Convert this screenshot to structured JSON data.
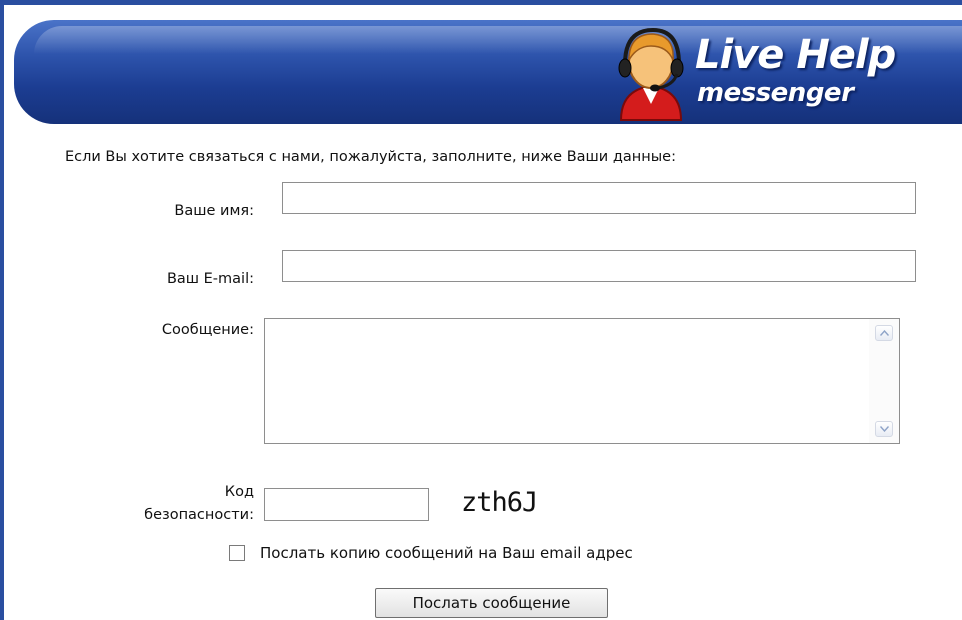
{
  "header": {
    "logo_line1": "Live Help",
    "logo_line2": "messenger",
    "icon": "headset-operator-icon",
    "colors": {
      "header_dark": "#15317a",
      "header_light": "#4a73c8",
      "frame": "#2a4ea0"
    }
  },
  "form": {
    "intro": "Если Вы хотите связаться с нами, пожалуйста, заполните, ниже Ваши данные:",
    "name_label": "Ваше имя:",
    "name_value": "",
    "email_label": "Ваш E-mail:",
    "email_value": "",
    "message_label": "Сообщение:",
    "message_value": "",
    "captcha_label_line1": "Код",
    "captcha_label_line2": "безопасности:",
    "captcha_value": "",
    "captcha_code": "zth6J",
    "copy_checkbox_label": "Послать копию сообщений на Ваш email адрес",
    "copy_checked": false,
    "submit_label": "Послать сообщение",
    "scroll_up_icon": "scroll-up-arrow-icon",
    "scroll_down_icon": "scroll-down-arrow-icon"
  }
}
